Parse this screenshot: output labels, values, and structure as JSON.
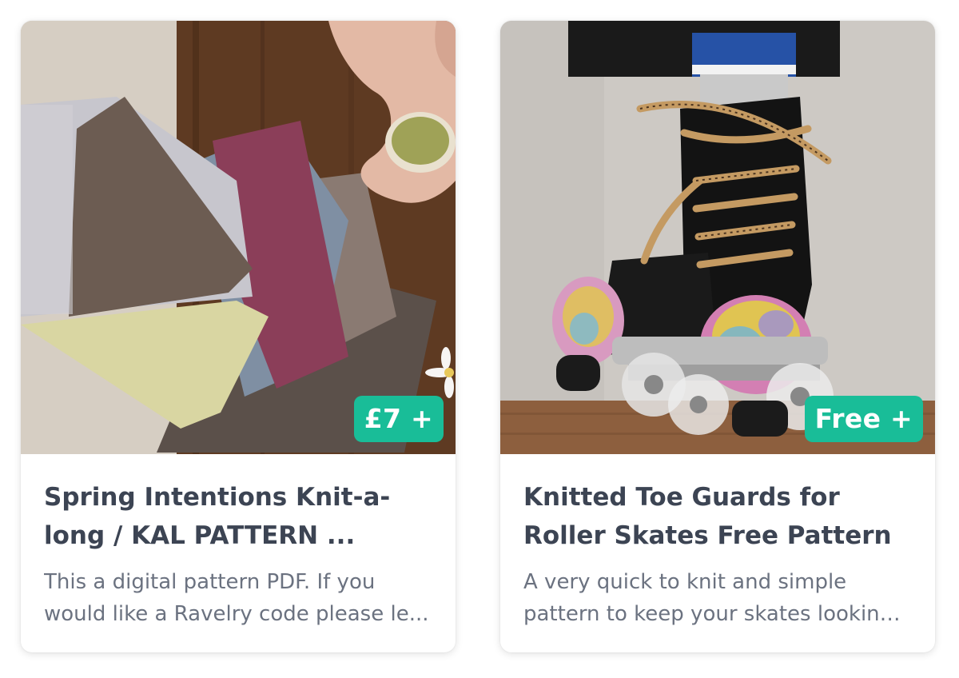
{
  "cards": [
    {
      "image_alt": "Folded hand-knitted cloths in grey, brown, blue, plum and yellow on a wooden table beside a cup of matcha",
      "price": "£7 +",
      "title": "Spring Intentions Knit-a-long / KAL PATTERN ...",
      "description": "This a digital pattern PDF. If you would like a Ravelry code please le..."
    },
    {
      "image_alt": "Roller skate with leopard-print laces wearing colourful knitted toe guards",
      "price": "Free +",
      "title": "Knitted Toe Guards for Roller Skates Free Pattern",
      "description": "A very quick to knit and simple pattern to keep your skates looking ..."
    }
  ],
  "colors": {
    "badge": "#19bd98",
    "title": "#3c4453",
    "description": "#6b7280"
  }
}
